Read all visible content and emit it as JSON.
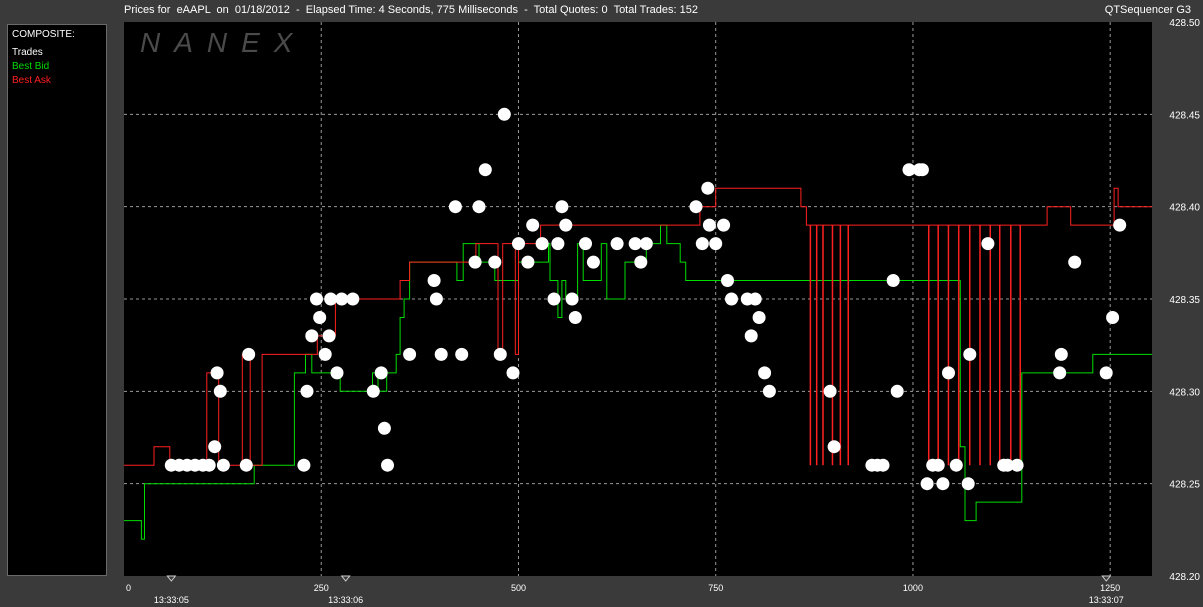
{
  "header": {
    "title": "Prices for  eAAPL  on  01/18/2012  -  Elapsed Time: 4 Seconds, 775 Milliseconds  -  Total Quotes: 0  Total Trades: 152",
    "app_name": "QTSequencer G3"
  },
  "legend": {
    "heading": "COMPOSITE:",
    "items": [
      {
        "label": "Trades",
        "color": "#ffffff"
      },
      {
        "label": "Best Bid",
        "color": "#00dd00"
      },
      {
        "label": "Best Ask",
        "color": "#ff2020"
      }
    ]
  },
  "watermark": "NANEX",
  "chart_data": {
    "type": "line",
    "xlim": [
      0,
      1303
    ],
    "ylim": [
      428.2,
      428.5
    ],
    "x_ticks": [
      0,
      250,
      500,
      750,
      1000,
      1250
    ],
    "y_ticks": [
      "428.20",
      "428.25",
      "428.30",
      "428.35",
      "428.40",
      "428.45",
      "428.50"
    ],
    "time_labels": [
      {
        "x": 60,
        "label": "13:33:05"
      },
      {
        "x": 281,
        "label": "13:33:06"
      },
      {
        "x": 1245,
        "label": "13:33:07"
      }
    ],
    "grid": true,
    "series": [
      {
        "name": "Best Bid",
        "color": "#00dd00",
        "points": [
          [
            0,
            428.23
          ],
          [
            22,
            428.23
          ],
          [
            22,
            428.22
          ],
          [
            26,
            428.22
          ],
          [
            26,
            428.25
          ],
          [
            165,
            428.25
          ],
          [
            165,
            428.26
          ],
          [
            216,
            428.26
          ],
          [
            216,
            428.31
          ],
          [
            230,
            428.31
          ],
          [
            230,
            428.32
          ],
          [
            238,
            428.32
          ],
          [
            238,
            428.31
          ],
          [
            274,
            428.31
          ],
          [
            274,
            428.3
          ],
          [
            315,
            428.3
          ],
          [
            315,
            428.31
          ],
          [
            322,
            428.31
          ],
          [
            322,
            428.3
          ],
          [
            333,
            428.3
          ],
          [
            333,
            428.31
          ],
          [
            345,
            428.31
          ],
          [
            345,
            428.32
          ],
          [
            350,
            428.32
          ],
          [
            350,
            428.34
          ],
          [
            355,
            428.34
          ],
          [
            355,
            428.35
          ],
          [
            362,
            428.35
          ],
          [
            362,
            428.37
          ],
          [
            422,
            428.37
          ],
          [
            422,
            428.36
          ],
          [
            430,
            428.36
          ],
          [
            430,
            428.38
          ],
          [
            450,
            428.38
          ],
          [
            450,
            428.37
          ],
          [
            470,
            428.37
          ],
          [
            470,
            428.36
          ],
          [
            500,
            428.36
          ],
          [
            500,
            428.37
          ],
          [
            538,
            428.37
          ],
          [
            538,
            428.38
          ],
          [
            540,
            428.38
          ],
          [
            540,
            428.36
          ],
          [
            550,
            428.36
          ],
          [
            550,
            428.34
          ],
          [
            555,
            428.34
          ],
          [
            555,
            428.36
          ],
          [
            560,
            428.36
          ],
          [
            560,
            428.35
          ],
          [
            575,
            428.35
          ],
          [
            575,
            428.38
          ],
          [
            582,
            428.38
          ],
          [
            582,
            428.36
          ],
          [
            605,
            428.36
          ],
          [
            605,
            428.38
          ],
          [
            612,
            428.38
          ],
          [
            612,
            428.35
          ],
          [
            635,
            428.35
          ],
          [
            635,
            428.37
          ],
          [
            662,
            428.37
          ],
          [
            662,
            428.38
          ],
          [
            680,
            428.38
          ],
          [
            680,
            428.39
          ],
          [
            688,
            428.39
          ],
          [
            688,
            428.38
          ],
          [
            705,
            428.38
          ],
          [
            705,
            428.37
          ],
          [
            712,
            428.37
          ],
          [
            712,
            428.36
          ],
          [
            1060,
            428.36
          ],
          [
            1060,
            428.27
          ],
          [
            1066,
            428.27
          ],
          [
            1066,
            428.23
          ],
          [
            1080,
            428.23
          ],
          [
            1080,
            428.24
          ],
          [
            1138,
            428.24
          ],
          [
            1138,
            428.31
          ],
          [
            1228,
            428.31
          ],
          [
            1228,
            428.32
          ],
          [
            1303,
            428.32
          ]
        ]
      },
      {
        "name": "Best Ask",
        "color": "#ff2020",
        "points": [
          [
            0,
            428.26
          ],
          [
            38,
            428.26
          ],
          [
            38,
            428.27
          ],
          [
            58,
            428.27
          ],
          [
            58,
            428.26
          ],
          [
            105,
            428.26
          ],
          [
            105,
            428.31
          ],
          [
            120,
            428.31
          ],
          [
            120,
            428.26
          ],
          [
            150,
            428.26
          ],
          [
            150,
            428.32
          ],
          [
            160,
            428.32
          ],
          [
            160,
            428.26
          ],
          [
            175,
            428.26
          ],
          [
            175,
            428.32
          ],
          [
            245,
            428.32
          ],
          [
            245,
            428.33
          ],
          [
            268,
            428.33
          ],
          [
            268,
            428.35
          ],
          [
            350,
            428.35
          ],
          [
            350,
            428.36
          ],
          [
            362,
            428.36
          ],
          [
            362,
            428.37
          ],
          [
            446,
            428.37
          ],
          [
            446,
            428.38
          ],
          [
            474,
            428.38
          ],
          [
            474,
            428.32
          ],
          [
            480,
            428.32
          ],
          [
            480,
            428.38
          ],
          [
            496,
            428.38
          ],
          [
            496,
            428.32
          ],
          [
            500,
            428.32
          ],
          [
            500,
            428.38
          ],
          [
            528,
            428.38
          ],
          [
            528,
            428.39
          ],
          [
            730,
            428.39
          ],
          [
            730,
            428.4
          ],
          [
            750,
            428.4
          ],
          [
            750,
            428.41
          ],
          [
            858,
            428.41
          ],
          [
            858,
            428.4
          ],
          [
            865,
            428.4
          ],
          [
            865,
            428.39
          ],
          [
            1170,
            428.39
          ],
          [
            1170,
            428.4
          ],
          [
            1200,
            428.4
          ],
          [
            1200,
            428.39
          ],
          [
            1255,
            428.39
          ],
          [
            1255,
            428.41
          ],
          [
            1260,
            428.41
          ],
          [
            1260,
            428.4
          ],
          [
            1303,
            428.4
          ]
        ],
        "spikes": [
          {
            "x": 870,
            "low": 428.26
          },
          {
            "x": 878,
            "low": 428.26
          },
          {
            "x": 886,
            "low": 428.26
          },
          {
            "x": 898,
            "low": 428.26
          },
          {
            "x": 908,
            "low": 428.26
          },
          {
            "x": 918,
            "low": 428.26
          },
          {
            "x": 1020,
            "low": 428.26
          },
          {
            "x": 1032,
            "low": 428.26
          },
          {
            "x": 1045,
            "low": 428.26
          },
          {
            "x": 1058,
            "low": 428.26
          },
          {
            "x": 1072,
            "low": 428.26
          },
          {
            "x": 1085,
            "low": 428.26
          },
          {
            "x": 1098,
            "low": 428.26
          },
          {
            "x": 1110,
            "low": 428.26
          },
          {
            "x": 1124,
            "low": 428.26
          },
          {
            "x": 1136,
            "low": 428.26
          }
        ]
      },
      {
        "name": "Trades",
        "color": "#ffffff",
        "points": [
          [
            60,
            428.26
          ],
          [
            70,
            428.26
          ],
          [
            80,
            428.26
          ],
          [
            90,
            428.26
          ],
          [
            100,
            428.26
          ],
          [
            108,
            428.26
          ],
          [
            115,
            428.27
          ],
          [
            118,
            428.31
          ],
          [
            122,
            428.3
          ],
          [
            126,
            428.26
          ],
          [
            155,
            428.26
          ],
          [
            158,
            428.32
          ],
          [
            228,
            428.26
          ],
          [
            232,
            428.3
          ],
          [
            238,
            428.33
          ],
          [
            244,
            428.35
          ],
          [
            248,
            428.34
          ],
          [
            255,
            428.32
          ],
          [
            260,
            428.33
          ],
          [
            262,
            428.35
          ],
          [
            270,
            428.31
          ],
          [
            276,
            428.35
          ],
          [
            290,
            428.35
          ],
          [
            316,
            428.3
          ],
          [
            326,
            428.31
          ],
          [
            330,
            428.28
          ],
          [
            334,
            428.26
          ],
          [
            362,
            428.32
          ],
          [
            393,
            428.36
          ],
          [
            396,
            428.35
          ],
          [
            402,
            428.32
          ],
          [
            420,
            428.4
          ],
          [
            428,
            428.32
          ],
          [
            445,
            428.37
          ],
          [
            450,
            428.4
          ],
          [
            458,
            428.42
          ],
          [
            470,
            428.37
          ],
          [
            477,
            428.32
          ],
          [
            482,
            428.45
          ],
          [
            493,
            428.31
          ],
          [
            500,
            428.38
          ],
          [
            512,
            428.37
          ],
          [
            518,
            428.39
          ],
          [
            530,
            428.38
          ],
          [
            545,
            428.35
          ],
          [
            550,
            428.38
          ],
          [
            555,
            428.4
          ],
          [
            560,
            428.39
          ],
          [
            568,
            428.35
          ],
          [
            572,
            428.34
          ],
          [
            585,
            428.38
          ],
          [
            595,
            428.37
          ],
          [
            625,
            428.38
          ],
          [
            648,
            428.38
          ],
          [
            655,
            428.37
          ],
          [
            662,
            428.38
          ],
          [
            725,
            428.4
          ],
          [
            733,
            428.38
          ],
          [
            740,
            428.41
          ],
          [
            742,
            428.39
          ],
          [
            750,
            428.38
          ],
          [
            760,
            428.39
          ],
          [
            765,
            428.36
          ],
          [
            770,
            428.35
          ],
          [
            790,
            428.35
          ],
          [
            795,
            428.33
          ],
          [
            800,
            428.35
          ],
          [
            805,
            428.34
          ],
          [
            812,
            428.31
          ],
          [
            818,
            428.3
          ],
          [
            895,
            428.3
          ],
          [
            900,
            428.27
          ],
          [
            948,
            428.26
          ],
          [
            955,
            428.26
          ],
          [
            962,
            428.26
          ],
          [
            975,
            428.36
          ],
          [
            980,
            428.3
          ],
          [
            995,
            428.42
          ],
          [
            1008,
            428.42
          ],
          [
            1012,
            428.42
          ],
          [
            1018,
            428.25
          ],
          [
            1025,
            428.26
          ],
          [
            1032,
            428.26
          ],
          [
            1038,
            428.25
          ],
          [
            1045,
            428.31
          ],
          [
            1055,
            428.26
          ],
          [
            1070,
            428.25
          ],
          [
            1072,
            428.32
          ],
          [
            1095,
            428.38
          ],
          [
            1115,
            428.26
          ],
          [
            1120,
            428.26
          ],
          [
            1132,
            428.26
          ],
          [
            1186,
            428.31
          ],
          [
            1188,
            428.32
          ],
          [
            1205,
            428.37
          ],
          [
            1245,
            428.31
          ],
          [
            1253,
            428.34
          ],
          [
            1262,
            428.39
          ]
        ]
      }
    ]
  }
}
